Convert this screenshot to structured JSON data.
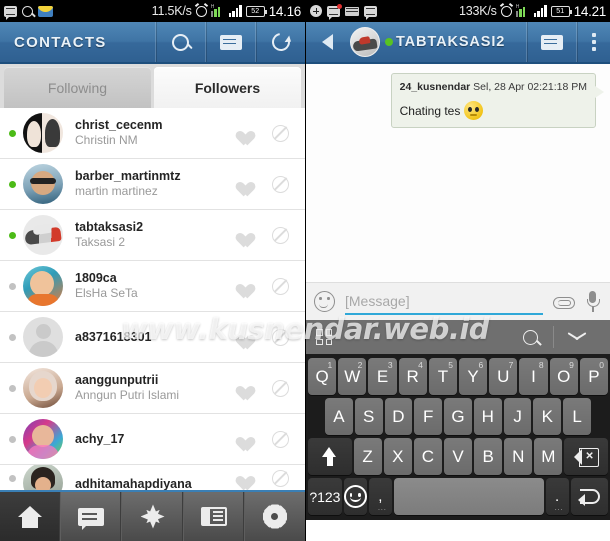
{
  "left": {
    "statusbar": {
      "icons": [
        "message-icon",
        "search-icon",
        "mail-icon"
      ],
      "data_rate": "11.5K/s",
      "battery": "52",
      "time": "14.16"
    },
    "actionbar": {
      "title": "CONTACTS",
      "buttons": [
        "search-icon",
        "list-icon",
        "refresh-icon"
      ]
    },
    "tabs": [
      {
        "label": "Following",
        "active": false
      },
      {
        "label": "Followers",
        "active": true
      }
    ],
    "contacts": [
      {
        "username": "christ_cecenm",
        "realname": "Christin NM",
        "online": true,
        "avatar": "a"
      },
      {
        "username": "barber_martinmtz",
        "realname": "martin martinez",
        "online": true,
        "avatar": "b"
      },
      {
        "username": "tabtaksasi2",
        "realname": "Taksasi 2",
        "online": true,
        "avatar": "c"
      },
      {
        "username": "1809ca",
        "realname": "ElsHa SeTa",
        "online": false,
        "avatar": "d"
      },
      {
        "username": "a8371618301",
        "realname": "",
        "online": false,
        "avatar": "e"
      },
      {
        "username": "aanggunputrii",
        "realname": "Anngun Putri Islami",
        "online": false,
        "avatar": "f"
      },
      {
        "username": "achy_17",
        "realname": "",
        "online": false,
        "avatar": "g"
      },
      {
        "username": "adhitamahapdiyana",
        "realname": "",
        "online": false,
        "avatar": "h"
      }
    ],
    "row_actions": {
      "favorite": "heart-icon",
      "block": "block-icon"
    },
    "bottomnav": [
      {
        "name": "home-icon",
        "selected": true
      },
      {
        "name": "messages-icon",
        "selected": false
      },
      {
        "name": "explore-icon",
        "selected": false
      },
      {
        "name": "panel-icon",
        "selected": false
      },
      {
        "name": "settings-icon",
        "selected": false
      }
    ]
  },
  "right": {
    "statusbar": {
      "icons": [
        "add-icon",
        "message-badge-icon",
        "keyboard-icon",
        "message-icon"
      ],
      "data_rate": "133K/s",
      "battery": "51",
      "time": "14.21"
    },
    "actionbar": {
      "back": "back-icon",
      "contact_name": "TABTAKSASI2",
      "presence": "online",
      "buttons": [
        "list-icon",
        "overflow-icon"
      ]
    },
    "chat": {
      "messages": [
        {
          "sender": "24_kusnendar",
          "timestamp": "Sel, 28 Apr 02:21:18 PM",
          "text": "Chating tes",
          "emoji": "smiley-emoji"
        }
      ]
    },
    "input": {
      "emoji_button": "smiley-icon",
      "placeholder": "[Message]",
      "value": "",
      "attach_button": "paperclip-icon",
      "mic_button": "microphone-icon"
    },
    "kbtoolbar": {
      "grid_button": "grid-icon",
      "search_button": "search-icon",
      "hide_button": "chevron-down-icon"
    },
    "keyboard": {
      "row1": [
        {
          "k": "Q",
          "n": "1"
        },
        {
          "k": "W",
          "n": "2"
        },
        {
          "k": "E",
          "n": "3"
        },
        {
          "k": "R",
          "n": "4"
        },
        {
          "k": "T",
          "n": "5"
        },
        {
          "k": "Y",
          "n": "6"
        },
        {
          "k": "U",
          "n": "7"
        },
        {
          "k": "I",
          "n": "8"
        },
        {
          "k": "O",
          "n": "9"
        },
        {
          "k": "P",
          "n": "0"
        }
      ],
      "row2": [
        "A",
        "S",
        "D",
        "F",
        "G",
        "H",
        "J",
        "K",
        "L"
      ],
      "row3_shift": "shift-icon",
      "row3": [
        "Z",
        "X",
        "C",
        "V",
        "B",
        "N",
        "M"
      ],
      "row3_backspace": "backspace-icon",
      "row4": {
        "symbols": "?123",
        "emoji": "smiley-icon",
        "comma": ",",
        "space": "",
        "period": ".",
        "enter": "enter-icon"
      }
    }
  },
  "watermark": "www.kusnendar.web.id",
  "colors": {
    "accent_blue": "#3f74a5",
    "online_green": "#4cbb17",
    "underline_blue": "#2fa8d8",
    "bubble_bg": "#eef2ea"
  }
}
